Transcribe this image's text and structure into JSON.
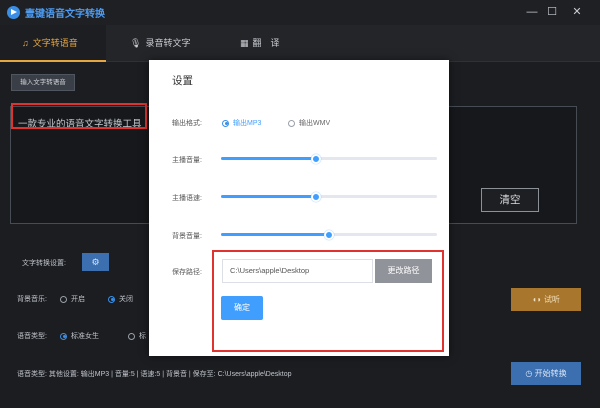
{
  "app": {
    "title": "壹键语音文字转换",
    "logo_icon": "app-logo-icon"
  },
  "window": {
    "minimize": "—",
    "maximize": "☐",
    "close": "✕"
  },
  "tabs": [
    {
      "label": "文字转语音",
      "icon": "text-to-speech-icon",
      "active": true
    },
    {
      "label": "录音转文字",
      "icon": "microphone-icon",
      "active": false
    },
    {
      "label": "翻　译",
      "icon": "translate-icon",
      "active": false
    }
  ],
  "main": {
    "input_text_button": "输入文字转语音",
    "text_content": "一款专业的语音文字转换工具",
    "clear_button": "清空",
    "settings_label": "文字转换设置:",
    "settings_button": "⚙",
    "bg_music": {
      "label": "背景音乐:",
      "options": [
        "开启",
        "关闭"
      ],
      "selected": "关闭"
    },
    "voice_type": {
      "label": "语音类型:",
      "options": [
        "标准女生",
        "标"
      ],
      "selected": "标准女生"
    },
    "listen_button": "试听",
    "start_button": "开始转换",
    "info_line": "语音类型:  其他设置:  输出MP3 | 音量:5 | 语速:5 | 背景音 | 保存至: C:\\Users\\apple\\Desktop"
  },
  "modal": {
    "title": "设置",
    "output_format": {
      "label": "输出格式:",
      "options": [
        "输出MP3",
        "输出WMV"
      ],
      "selected": "输出MP3"
    },
    "volume": {
      "label": "主播音量:",
      "level": 0.44
    },
    "speed": {
      "label": "主播语速:",
      "level": 0.44
    },
    "bg_volume": {
      "label": "背景音量:",
      "level": 0.5
    },
    "save_path": {
      "label": "保存路径:",
      "value": "C:\\Users\\apple\\Desktop",
      "change_button": "更改路径"
    },
    "ok_button": "确定"
  },
  "colors": {
    "accent_orange": "#e6a642",
    "accent_blue": "#409eff",
    "highlight_red": "#e0322f"
  }
}
